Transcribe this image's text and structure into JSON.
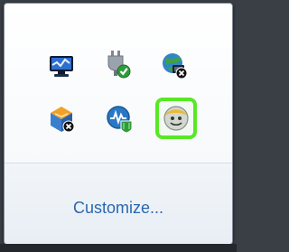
{
  "flyout": {
    "customize_label": "Customize..."
  },
  "icons": [
    {
      "name": "action-center-icon"
    },
    {
      "name": "power-plugged-icon"
    },
    {
      "name": "network-disconnected-icon"
    },
    {
      "name": "windows-update-icon"
    },
    {
      "name": "security-shield-icon"
    },
    {
      "name": "app-face-icon"
    }
  ],
  "colors": {
    "highlight": "#58e826",
    "link": "#2a67b0"
  }
}
